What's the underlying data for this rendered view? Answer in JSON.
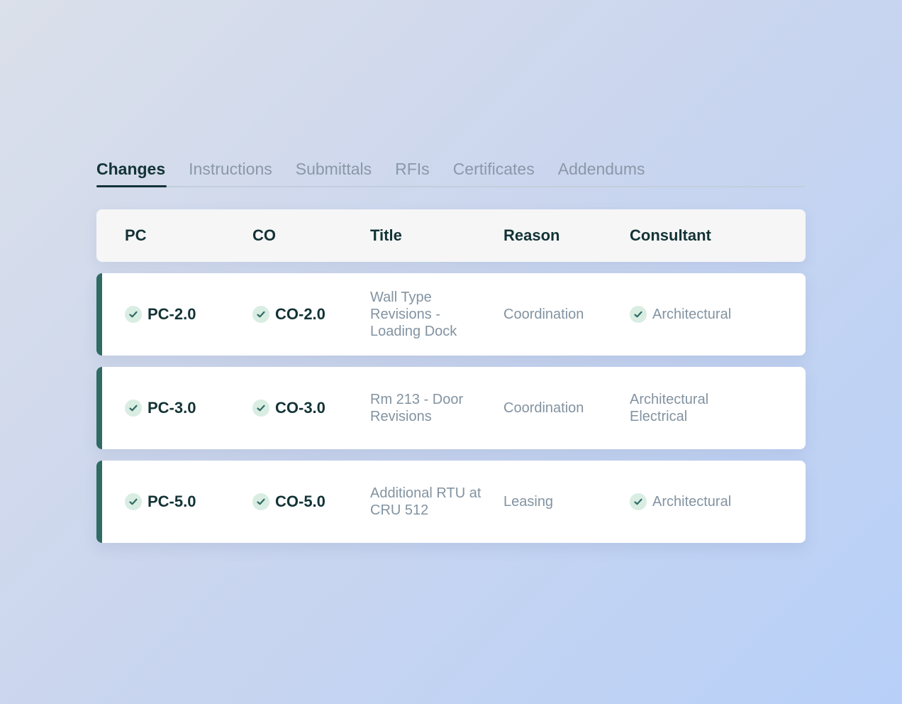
{
  "tabs": [
    {
      "label": "Changes",
      "active": true
    },
    {
      "label": "Instructions"
    },
    {
      "label": "Submittals"
    },
    {
      "label": "RFIs"
    },
    {
      "label": "Certificates"
    },
    {
      "label": "Addendums"
    }
  ],
  "table": {
    "headers": {
      "pc": "PC",
      "co": "CO",
      "title": "Title",
      "reason": "Reason",
      "consultant": "Consultant"
    },
    "rows": [
      {
        "pc": "PC-2.0",
        "co": "CO-2.0",
        "title": "Wall Type Revisions - Loading Dock",
        "reason": "Coordination",
        "consultant_line1": "Architectural",
        "consultant_line2": "",
        "consultant_check": true
      },
      {
        "pc": "PC-3.0",
        "co": "CO-3.0",
        "title": "Rm 213 - Door Revisions",
        "reason": "Coordination",
        "consultant_line1": "Architectural",
        "consultant_line2": "Electrical",
        "consultant_check": false
      },
      {
        "pc": "PC-5.0",
        "co": "CO-5.0",
        "title": "Additional RTU at CRU 512",
        "reason": "Leasing",
        "consultant_line1": "Architectural",
        "consultant_line2": "",
        "consultant_check": true
      }
    ]
  },
  "colors": {
    "accent": "#2f6b63",
    "text_dark": "#133336",
    "text_muted": "#8393a1",
    "check_bg": "#d9ede3"
  },
  "icons": {
    "status": "check-circle-icon"
  }
}
